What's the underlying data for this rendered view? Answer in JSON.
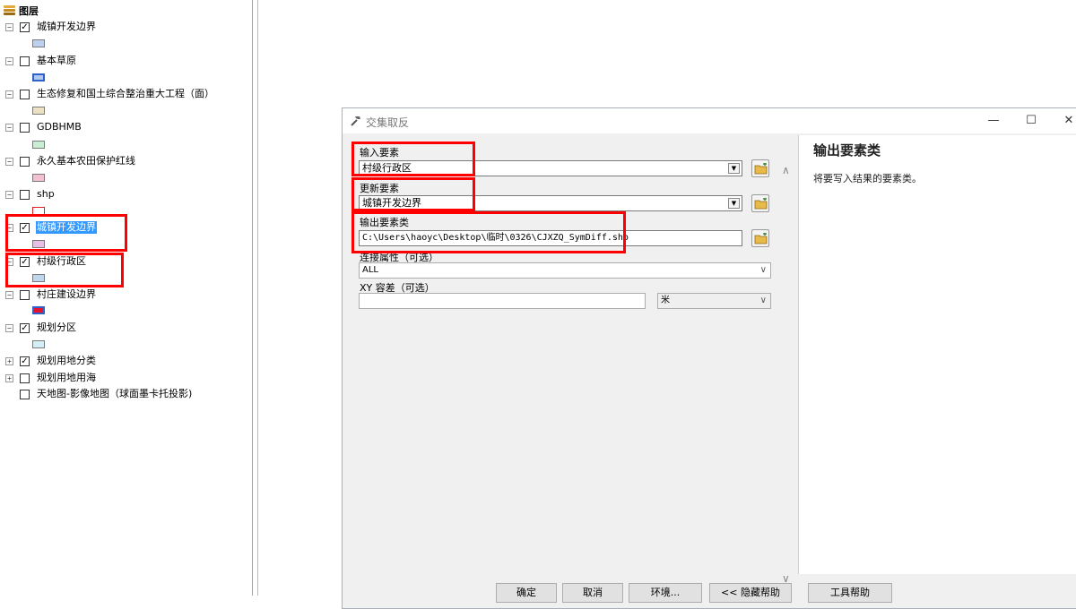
{
  "toc": {
    "root_label": "图层",
    "layers": [
      {
        "label": "城镇开发边界",
        "checked": true,
        "expanded": true,
        "swatch_fill": "#bdd0ef",
        "swatch_border": "#7a7a7a"
      },
      {
        "label": "基本草原",
        "checked": false,
        "expanded": true,
        "swatch_fill": "#b0c8f0",
        "swatch_border": "#2f62c9"
      },
      {
        "label": "生态修复和国土综合整治重大工程（面）",
        "checked": false,
        "expanded": true,
        "swatch_fill": "#ede1c4",
        "swatch_border": "#8d8d8d"
      },
      {
        "label": "GDBHMB",
        "checked": false,
        "expanded": true,
        "swatch_fill": "#c8efd4",
        "swatch_border": "#8d8d8d"
      },
      {
        "label": "永久基本农田保护红线",
        "checked": false,
        "expanded": true,
        "swatch_fill": "#f2c0d2",
        "swatch_border": "#8d8d8d"
      },
      {
        "label": "shp",
        "checked": false,
        "expanded": true,
        "swatch_fill": "#ffffff",
        "swatch_border": "#e02020"
      },
      {
        "label": "城镇开发边界",
        "checked": true,
        "expanded": true,
        "selected": true,
        "swatch_fill": "#e8bde6",
        "swatch_border": "#8d8d8d"
      },
      {
        "label": "村级行政区",
        "checked": true,
        "expanded": true,
        "swatch_fill": "#bfd7ee",
        "swatch_border": "#8d8d8d"
      },
      {
        "label": "村庄建设边界",
        "checked": false,
        "expanded": true,
        "swatch_fill": "#e8102a",
        "swatch_border": "#2f62c9"
      },
      {
        "label": "规划分区",
        "checked": true,
        "expanded": true,
        "swatch_fill": "#d4eef8",
        "swatch_border": "#8d8d8d"
      },
      {
        "label": "规划用地分类",
        "checked": true,
        "expanded": false
      },
      {
        "label": "规划用地用海",
        "checked": false,
        "expanded": false
      },
      {
        "label": "天地图-影像地图（球面墨卡托投影)",
        "checked": false,
        "expanded": null
      }
    ]
  },
  "dialog": {
    "title": "交集取反",
    "fields": {
      "input_label": "输入要素",
      "input_value": "村级行政区",
      "update_label": "更新要素",
      "update_value": "城镇开发边界",
      "output_label": "输出要素类",
      "output_value": "C:\\Users\\haoyc\\Desktop\\临时\\0326\\CJXZQ_SymDiff.shp",
      "join_label": "连接属性（可选）",
      "join_value": "ALL",
      "xy_label": "XY 容差（可选）",
      "xy_value": "",
      "xy_unit": "米"
    },
    "help": {
      "title": "输出要素类",
      "text": "将要写入结果的要素类。"
    },
    "buttons": {
      "ok": "确定",
      "cancel": "取消",
      "env": "环境...",
      "hide_help": "<< 隐藏帮助",
      "tool_help": "工具帮助"
    }
  },
  "colors": {
    "highlight": "#ff0000",
    "selection": "#3399ff"
  }
}
